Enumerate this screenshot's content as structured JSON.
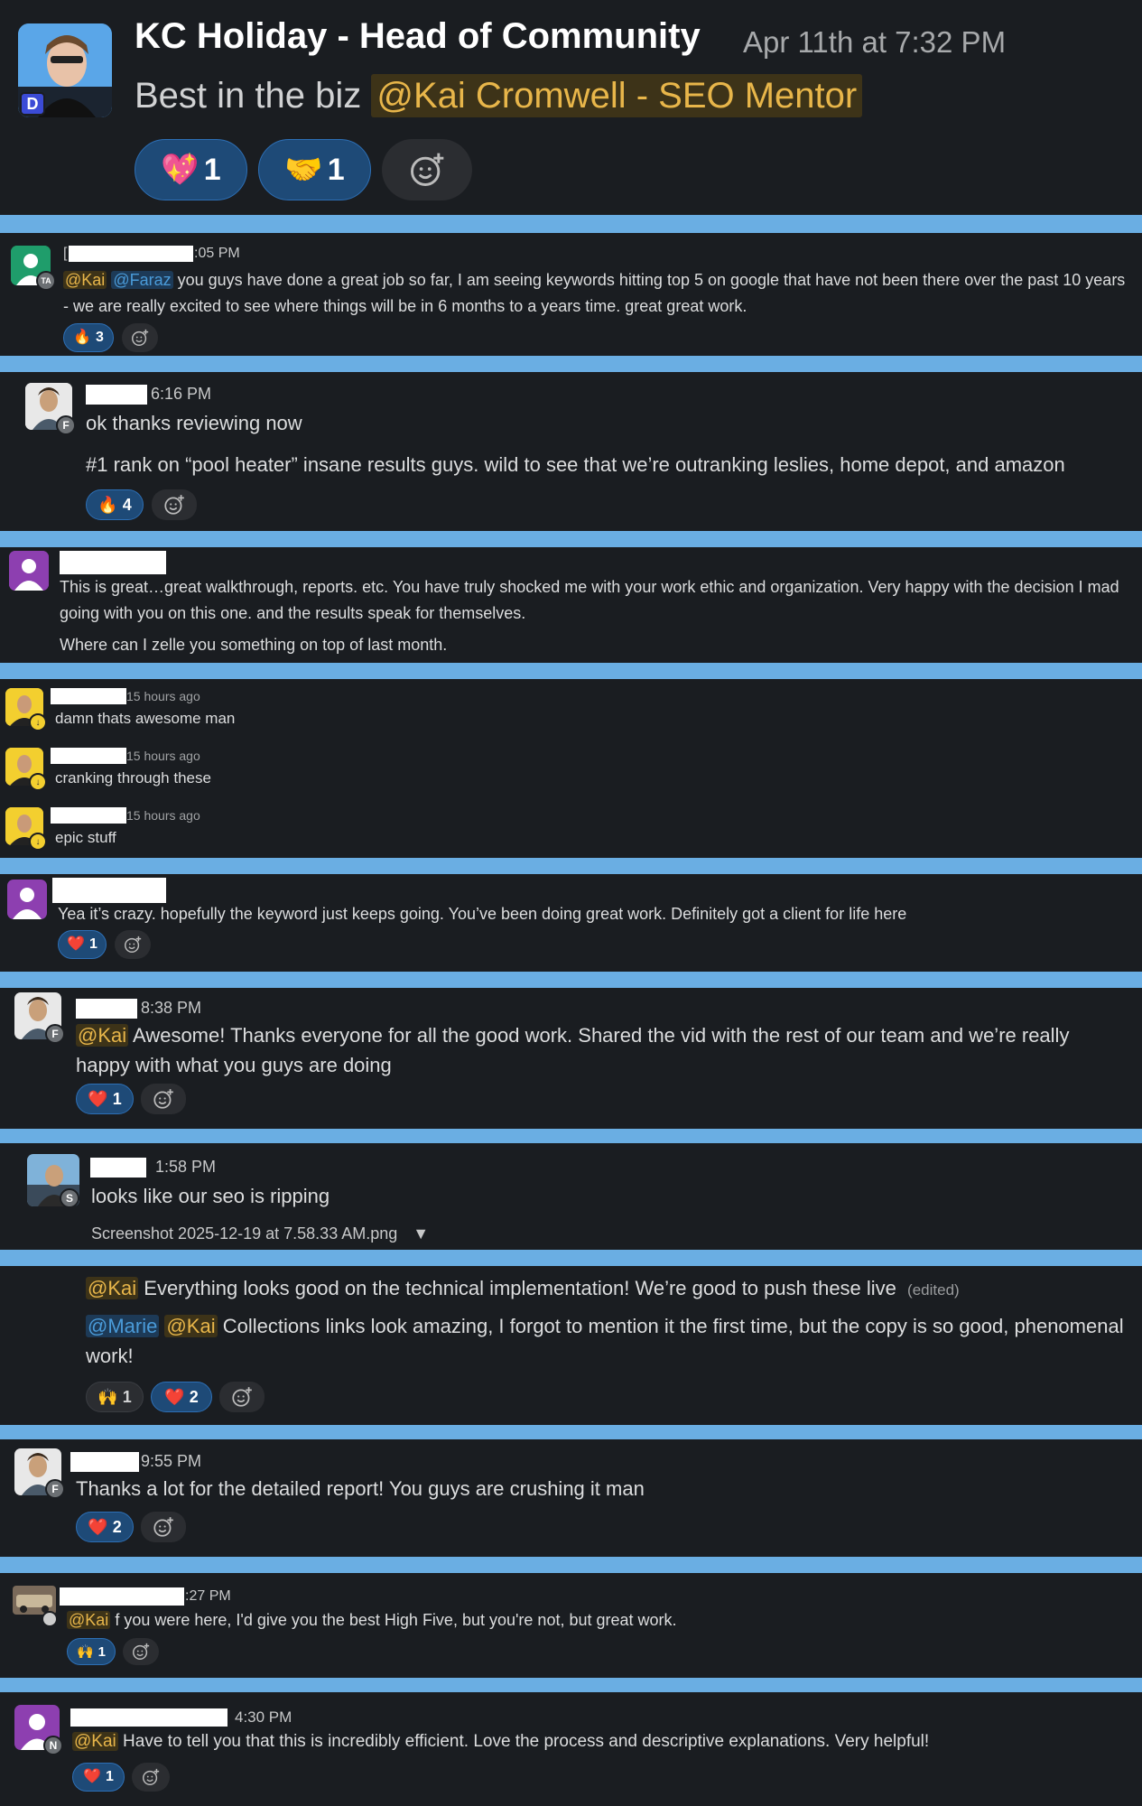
{
  "top_post": {
    "author": "KC Holiday - Head of Community",
    "timestamp": "Apr 11th at 7:32 PM",
    "avatar_badge": "D",
    "text": "Best in the biz",
    "mention": "@Kai Cromwell - SEO Mentor",
    "reactions": [
      {
        "icon": "heart-face-icon",
        "glyph": "💖",
        "count": "1"
      },
      {
        "icon": "handshake-icon",
        "glyph": "🤝",
        "count": "1"
      }
    ]
  },
  "messages": {
    "m1": {
      "name_prefix": "[",
      "time": ":05 PM",
      "badge": "TA",
      "mention1": "@Kai",
      "mention2": "@Faraz",
      "text": "you guys have done a great job so far, I am seeing keywords hitting top 5 on google that have not been there over the past 10 years - we are really excited to see where things will be in 6 months to a years time. great great work.",
      "reaction": {
        "icon": "fire-icon",
        "glyph": "🔥",
        "count": "3"
      }
    },
    "m2": {
      "time": "6:16 PM",
      "badge": "F",
      "line1": "ok thanks reviewing now",
      "line2": "#1 rank on “pool heater” insane results guys. wild to see that we’re outranking leslies, home depot, and amazon",
      "reaction": {
        "icon": "fire-icon",
        "glyph": "🔥",
        "count": "4"
      }
    },
    "m3": {
      "line1": "This is great…great walkthrough, reports. etc. You have truly shocked me with your work ethic and organization. Very happy with the decision I mad going with you on this one. and the results speak for themselves.",
      "line2": "Where can I zelle you something on top of last month."
    },
    "m4": [
      {
        "time": "15 hours ago",
        "text": "damn thats awesome man"
      },
      {
        "time": "15 hours ago",
        "text": "cranking through these"
      },
      {
        "time": "15 hours ago",
        "text": "epic stuff"
      }
    ],
    "m5": {
      "text": "Yea it’s crazy. hopefully the keyword just keeps going. You’ve been doing great work. Definitely got a client for life here",
      "reaction": {
        "icon": "heart-icon",
        "glyph": "❤️",
        "count": "1"
      }
    },
    "m6": {
      "time": "8:38 PM",
      "badge": "F",
      "mention": "@Kai",
      "text": "Awesome! Thanks everyone for all the good work. Shared the vid with the rest of our team and we’re really happy with what you guys are doing",
      "reaction": {
        "icon": "heart-icon",
        "glyph": "❤️",
        "count": "1"
      }
    },
    "m7": {
      "time": "1:58 PM",
      "badge": "S",
      "text": "looks like our seo is ripping",
      "file": "Screenshot 2025-12-19 at 7.58.33 AM.png"
    },
    "m8": {
      "mention1": "@Kai",
      "text1": "Everything looks good on the technical implementation! We’re good to push these live",
      "edited": "(edited)",
      "mention2": "@Marie",
      "mention3": "@Kai",
      "text2": "Collections links look amazing, I forgot to mention it the first time, but the copy is so good, phenomenal work!",
      "reactions": [
        {
          "icon": "raised-hands-icon",
          "glyph": "🙌",
          "count": "1"
        },
        {
          "icon": "heart-icon",
          "glyph": "❤️",
          "count": "2"
        }
      ]
    },
    "m9": {
      "time": "9:55 PM",
      "badge": "F",
      "text": "Thanks a lot for the detailed report! You guys are crushing it man",
      "reaction": {
        "icon": "heart-icon",
        "glyph": "❤️",
        "count": "2"
      }
    },
    "m10": {
      "time": ":27 PM",
      "mention": "@Kai",
      "text": "f you were here, I'd give you the best High Five, but you're not, but great work.",
      "reaction": {
        "icon": "raised-hands-icon",
        "glyph": "🙌",
        "count": "1"
      }
    },
    "m11": {
      "time": "4:30 PM",
      "badge": "N",
      "mention": "@Kai",
      "text": "Have to tell you that this is incredibly efficient.  Love the process and descriptive explanations.  Very helpful!",
      "reaction": {
        "icon": "heart-icon",
        "glyph": "❤️",
        "count": "1"
      }
    }
  },
  "colors": {
    "background": "#1a1d21",
    "separator": "#6aaee3",
    "mention": "#e8b64a",
    "mention_blue": "#4a9bd9",
    "reaction": "#1e4a77"
  }
}
